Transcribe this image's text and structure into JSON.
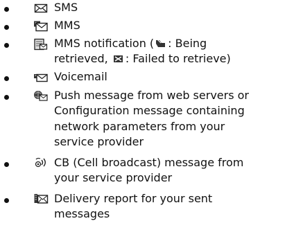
{
  "items": [
    {
      "icon": "sms-envelope-icon",
      "text": "SMS"
    },
    {
      "icon": "mms-envelope-icon",
      "text": "MMS"
    },
    {
      "icon": "mms-notification-icon",
      "line1_prefix": "MMS notification (",
      "line1_suffix": ": Being",
      "line2_prefix": "retrieved, ",
      "line2_suffix": ": Failed to retrieve)"
    },
    {
      "icon": "voicemail-icon",
      "text": "Voicemail"
    },
    {
      "icon": "push-message-icon",
      "lines": [
        "Push message from web servers or",
        "Configuration message containing",
        "network parameters from your",
        "service provider"
      ]
    },
    {
      "icon": "cell-broadcast-icon",
      "lines": [
        "CB (Cell broadcast) message from",
        "your service provider"
      ]
    },
    {
      "icon": "delivery-report-icon",
      "lines": [
        "Delivery report for your sent",
        "messages"
      ]
    }
  ]
}
